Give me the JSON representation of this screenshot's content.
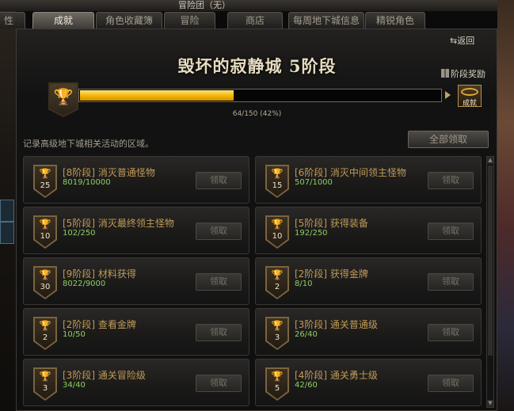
{
  "window": {
    "title": "冒险团（无）"
  },
  "tabs": [
    {
      "label": "性",
      "active": false
    },
    {
      "label": "成就",
      "active": true
    },
    {
      "label": "角色收藏簿",
      "active": false
    },
    {
      "label": "冒险",
      "active": false
    },
    {
      "label": "商店",
      "active": false
    },
    {
      "label": "每周地下城信息",
      "active": false
    },
    {
      "label": "精锐角色",
      "active": false
    }
  ],
  "header": {
    "back_label": "返回",
    "title": "毁坏的寂静城 5阶段",
    "stage_reward_label": "阶段奖励",
    "reward_chest_label": "成就"
  },
  "progress": {
    "current": 64,
    "total": 150,
    "percent": 42,
    "text": "64/150 (42%)"
  },
  "description": "记录高级地下城相关活动的区域。",
  "claim_all_label": "全部领取",
  "achievements": [
    {
      "stage": "[8阶段]",
      "name": "消灭普通怪物",
      "points": "25",
      "progress": "8019/10000",
      "claim_label": "领取"
    },
    {
      "stage": "[6阶段]",
      "name": "消灭中间领主怪物",
      "points": "15",
      "progress": "507/1000",
      "claim_label": "领取"
    },
    {
      "stage": "[5阶段]",
      "name": "消灭最终领主怪物",
      "points": "10",
      "progress": "102/250",
      "claim_label": "领取"
    },
    {
      "stage": "[5阶段]",
      "name": "获得装备",
      "points": "10",
      "progress": "192/250",
      "claim_label": "领取"
    },
    {
      "stage": "[9阶段]",
      "name": "材料获得",
      "points": "30",
      "progress": "8022/9000",
      "claim_label": "领取"
    },
    {
      "stage": "[2阶段]",
      "name": "获得金牌",
      "points": "2",
      "progress": "8/10",
      "claim_label": "领取"
    },
    {
      "stage": "[2阶段]",
      "name": "查看金牌",
      "points": "2",
      "progress": "10/50",
      "claim_label": "领取"
    },
    {
      "stage": "[3阶段]",
      "name": "通关普通级",
      "points": "3",
      "progress": "26/40",
      "claim_label": "领取"
    },
    {
      "stage": "[3阶段]",
      "name": "通关冒险级",
      "points": "3",
      "progress": "34/40",
      "claim_label": "领取"
    },
    {
      "stage": "[4阶段]",
      "name": "通关勇士级",
      "points": "5",
      "progress": "42/60",
      "claim_label": "领取"
    }
  ],
  "icons": {
    "trophy": "trophy-icon",
    "back": "back-arrow-icon",
    "gift": "gift-icon",
    "chest": "reward-chest-icon"
  },
  "colors": {
    "progress_fill": "#f4b400",
    "achievement_title": "#c09a57",
    "achievement_progress": "#8ccf62"
  }
}
